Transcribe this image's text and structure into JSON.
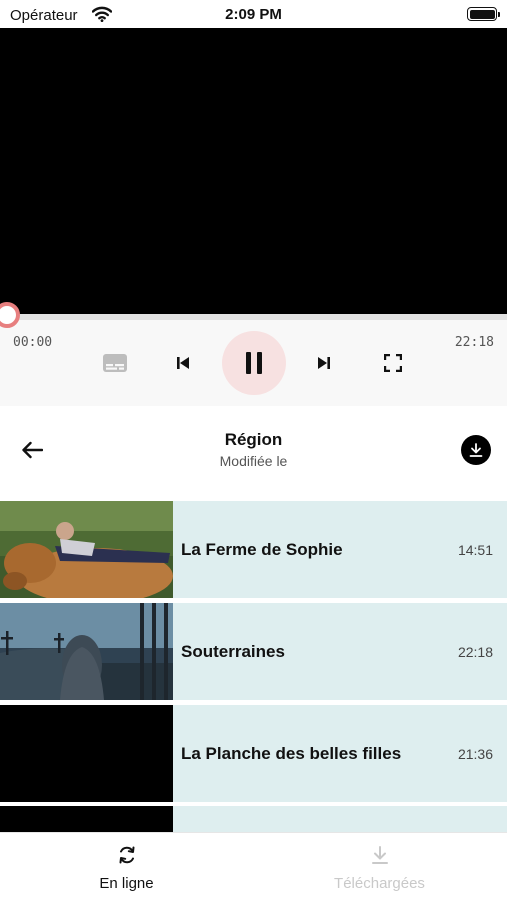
{
  "status_bar": {
    "carrier": "Opérateur",
    "time": "2:09 PM"
  },
  "player": {
    "elapsed": "00:00",
    "total": "22:18",
    "progress": 0,
    "accent_color": "#e77f7f",
    "icons": [
      "subtitles-icon",
      "previous-icon",
      "pause-icon",
      "next-icon",
      "fullscreen-icon"
    ]
  },
  "header": {
    "title": "Région",
    "subtitle": "Modifiée le"
  },
  "episodes": [
    {
      "title": "La Ferme de Sophie",
      "duration": "14:51"
    },
    {
      "title": "Souterraines",
      "duration": "22:18"
    },
    {
      "title": "La Planche des belles filles",
      "duration": "21:36"
    },
    {
      "title": "",
      "duration": ""
    }
  ],
  "row_color": "#deeeef",
  "tabs": [
    {
      "label": "En ligne",
      "icon": "refresh-icon",
      "active": true
    },
    {
      "label": "Téléchargées",
      "icon": "download-icon",
      "active": false
    }
  ]
}
